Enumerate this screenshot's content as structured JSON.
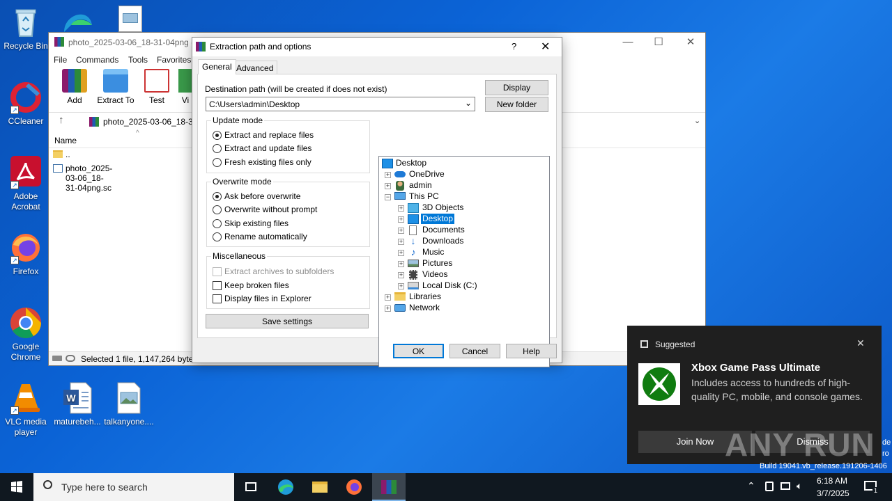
{
  "desktop": {
    "icons": [
      {
        "label": "Recycle Bin"
      },
      {
        "label": "CCleaner"
      },
      {
        "label": "Adobe Acrobat"
      },
      {
        "label": "Firefox"
      },
      {
        "label": "Google Chrome"
      },
      {
        "label": "VLC media player"
      },
      {
        "label": "maturebeh..."
      },
      {
        "label": "talkanyone...."
      }
    ],
    "watermark_text": "Build 19041.vb_release.191206-1406",
    "watermark_side_1": "de",
    "watermark_side_2": "ro",
    "anyrun_logo": "ANY RUN"
  },
  "winrar": {
    "title": "photo_2025-03-06_18-31-04png (2",
    "menu": [
      "File",
      "Commands",
      "Tools",
      "Favorites"
    ],
    "toolbar": [
      "Add",
      "Extract To",
      "Test",
      "Vi"
    ],
    "path": "photo_2025-03-06_18-31",
    "column_name": "Name",
    "files": [
      "..",
      "photo_2025-03-06_18-31-04png.sc"
    ],
    "status": "Selected 1 file, 1,147,264 bytes"
  },
  "dialog": {
    "title": "Extraction path and options",
    "help_glyph": "?",
    "close_glyph": "✕",
    "tabs": [
      "General",
      "Advanced"
    ],
    "dest_label": "Destination path (will be created if does not exist)",
    "dest_value": "C:\\Users\\admin\\Desktop",
    "display_button": "Display",
    "new_folder_button": "New folder",
    "update_mode": {
      "label": "Update mode",
      "options": [
        "Extract and replace files",
        "Extract and update files",
        "Fresh existing files only"
      ],
      "selected": 0
    },
    "overwrite_mode": {
      "label": "Overwrite mode",
      "options": [
        "Ask before overwrite",
        "Overwrite without prompt",
        "Skip existing files",
        "Rename automatically"
      ],
      "selected": 0
    },
    "misc": {
      "label": "Miscellaneous",
      "options": [
        "Extract archives to subfolders",
        "Keep broken files",
        "Display files in Explorer"
      ]
    },
    "save_settings": "Save settings",
    "tree": [
      {
        "label": "Desktop"
      },
      {
        "label": "OneDrive"
      },
      {
        "label": "admin"
      },
      {
        "label": "This PC"
      },
      {
        "label": "3D Objects"
      },
      {
        "label": "Desktop"
      },
      {
        "label": "Documents"
      },
      {
        "label": "Downloads"
      },
      {
        "label": "Music"
      },
      {
        "label": "Pictures"
      },
      {
        "label": "Videos"
      },
      {
        "label": "Local Disk (C:)"
      },
      {
        "label": "Libraries"
      },
      {
        "label": "Network"
      }
    ],
    "ok": "OK",
    "cancel": "Cancel",
    "help": "Help"
  },
  "toast": {
    "header": "Suggested",
    "title": "Xbox Game Pass Ultimate",
    "body": "Includes access to hundreds of high-quality PC, mobile, and console games.",
    "join": "Join Now",
    "dismiss": "Dismiss"
  },
  "taskbar": {
    "search_placeholder": "Type here to search",
    "time": "6:18 AM",
    "date": "3/7/2025",
    "notification_count": "1"
  },
  "colors": {
    "accent": "#0078d7",
    "selection": "#0078d7",
    "toast_bg": "#1f1f1f",
    "xbox_green": "#107c10"
  }
}
